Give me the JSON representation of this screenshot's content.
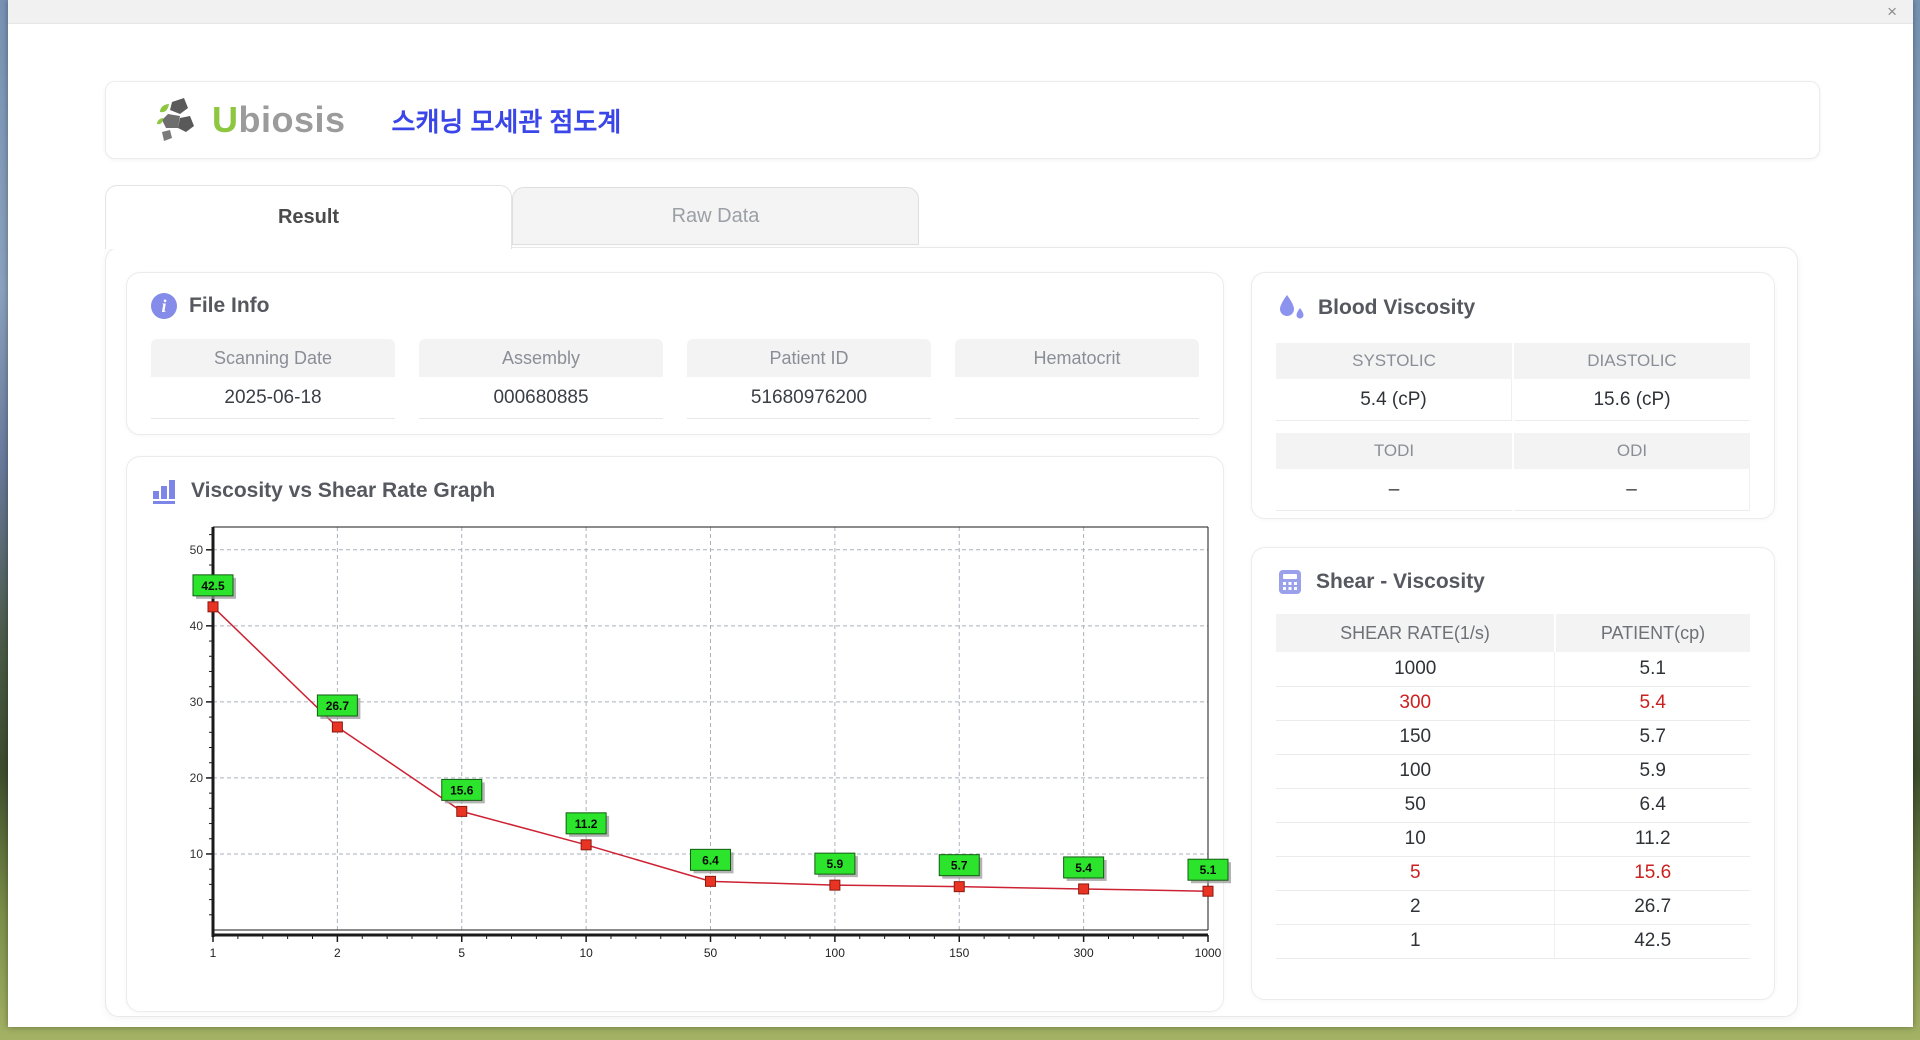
{
  "window": {
    "close_label": "×"
  },
  "header": {
    "logo_u": "U",
    "logo_rest": "biosis",
    "app_title": "스캐닝 모세관 점도계"
  },
  "tabs": {
    "result": "Result",
    "raw_data": "Raw Data"
  },
  "file_info": {
    "title": "File Info",
    "fields": [
      {
        "label": "Scanning Date",
        "value": "2025-06-18"
      },
      {
        "label": "Assembly",
        "value": "000680885"
      },
      {
        "label": "Patient ID",
        "value": "51680976200"
      },
      {
        "label": "Hematocrit",
        "value": ""
      }
    ]
  },
  "blood_viscosity": {
    "title": "Blood Viscosity",
    "cells": [
      {
        "label": "SYSTOLIC",
        "value": "5.4 (cP)"
      },
      {
        "label": "DIASTOLIC",
        "value": "15.6 (cP)"
      },
      {
        "label": "TODI",
        "value": "–"
      },
      {
        "label": "ODI",
        "value": "–"
      }
    ]
  },
  "shear_viscosity": {
    "title": "Shear - Viscosity",
    "columns": [
      "SHEAR RATE(1/s)",
      "PATIENT(cp)"
    ],
    "rows": [
      {
        "shear": "1000",
        "patient": "5.1",
        "highlight": false
      },
      {
        "shear": "300",
        "patient": "5.4",
        "highlight": true
      },
      {
        "shear": "150",
        "patient": "5.7",
        "highlight": false
      },
      {
        "shear": "100",
        "patient": "5.9",
        "highlight": false
      },
      {
        "shear": "50",
        "patient": "6.4",
        "highlight": false
      },
      {
        "shear": "10",
        "patient": "11.2",
        "highlight": false
      },
      {
        "shear": "5",
        "patient": "15.6",
        "highlight": true
      },
      {
        "shear": "2",
        "patient": "26.7",
        "highlight": false
      },
      {
        "shear": "1",
        "patient": "42.5",
        "highlight": false
      }
    ]
  },
  "graph": {
    "title": "Viscosity vs Shear Rate Graph"
  },
  "chart_data": {
    "type": "line",
    "title": "Viscosity vs Shear Rate Graph",
    "x_categories": [
      "1",
      "2",
      "5",
      "10",
      "50",
      "100",
      "150",
      "300",
      "1000"
    ],
    "values": [
      42.5,
      26.7,
      15.6,
      11.2,
      6.4,
      5.9,
      5.7,
      5.4,
      5.1
    ],
    "point_labels": [
      "42.5",
      "26.7",
      "15.6",
      "11.2",
      "6.4",
      "5.9",
      "5.7",
      "5.4",
      "5.1"
    ],
    "xlabel": "",
    "ylabel": "",
    "y_ticks": [
      10,
      20,
      30,
      40,
      50
    ],
    "ylim": [
      0,
      53
    ],
    "grid": "dashed",
    "legend": null,
    "colors": {
      "line": "#cc2233",
      "marker_fill": "#e93323",
      "marker_border": "#8b1a10",
      "label_bg": "#2be42b",
      "label_border": "#145c14",
      "grid_line": "#aab2be",
      "axis": "#1a1a1a"
    }
  },
  "theme": {
    "accent_blue": "#3a46e8",
    "logo_green": "#8dc63f",
    "icon_purple": "#848be8",
    "highlight_red": "#cc2020"
  }
}
